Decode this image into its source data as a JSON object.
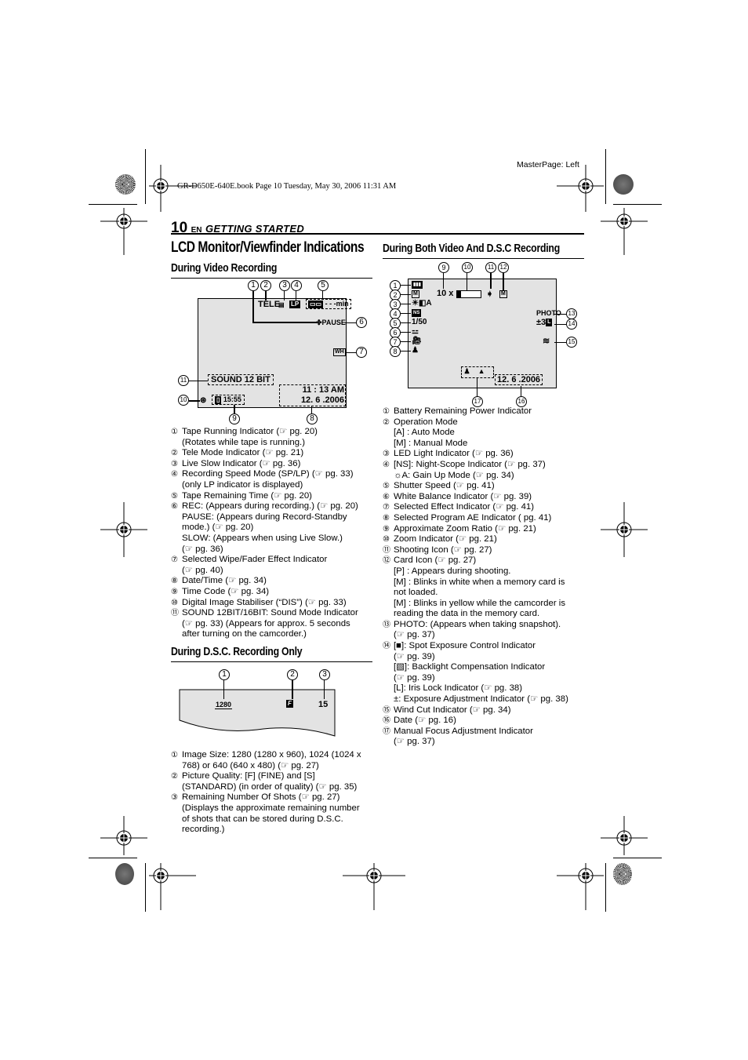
{
  "print_marks": {
    "slug": "GR-D650E-640E.book  Page 10  Tuesday, May 30, 2006  11:31 AM",
    "master_page": "MasterPage: Left"
  },
  "header": {
    "page_number": "10",
    "language": "EN",
    "section": "GETTING STARTED"
  },
  "title": "LCD Monitor/Viewfinder Indications",
  "video_recording": {
    "heading": "During Video Recording",
    "screen": {
      "tele": "TELE",
      "lp": "LP",
      "tape_remaining": "- - -min",
      "pause": "PAUSE",
      "wipe_icon": "WH",
      "sound": "SOUND  12 BIT",
      "time": "11 : 13  AM",
      "date": "12.  6 .2006",
      "timecode": "15:55"
    },
    "callouts": [
      "1",
      "2",
      "3",
      "4",
      "5",
      "6",
      "7",
      "8",
      "9",
      "10",
      "11"
    ],
    "items": [
      {
        "n": "①",
        "lines": [
          "Tape Running Indicator (☞ pg. 20)",
          "(Rotates while tape is running.)"
        ]
      },
      {
        "n": "②",
        "lines": [
          "Tele Mode Indicator (☞ pg. 21)"
        ]
      },
      {
        "n": "③",
        "lines": [
          "Live Slow Indicator (☞ pg. 36)"
        ]
      },
      {
        "n": "④",
        "lines": [
          "Recording Speed Mode (SP/LP) (☞ pg. 33)",
          "(only LP indicator is displayed)"
        ]
      },
      {
        "n": "⑤",
        "lines": [
          "Tape Remaining Time (☞ pg. 20)"
        ]
      },
      {
        "n": "⑥",
        "lines": [
          "REC: (Appears during recording.) (☞ pg. 20)",
          "PAUSE: (Appears during Record-Standby",
          "mode.) (☞ pg. 20)",
          "SLOW: (Appears when using Live Slow.)",
          "(☞ pg. 36)"
        ]
      },
      {
        "n": "⑦",
        "lines": [
          "Selected Wipe/Fader Effect Indicator",
          "(☞ pg. 40)"
        ]
      },
      {
        "n": "⑧",
        "lines": [
          "Date/Time (☞ pg. 34)"
        ]
      },
      {
        "n": "⑨",
        "lines": [
          "Time Code (☞ pg. 34)"
        ]
      },
      {
        "n": "⑩",
        "lines": [
          "Digital Image Stabiliser (“DIS”) (☞ pg. 33)"
        ]
      },
      {
        "n": "⑪",
        "lines": [
          "SOUND 12BIT/16BIT: Sound Mode Indicator",
          "(☞ pg. 33) (Appears for approx. 5 seconds",
          "after turning on the camcorder.)"
        ]
      }
    ]
  },
  "dsc_recording": {
    "heading": "During D.S.C. Recording Only",
    "screen": {
      "image_size": "1280",
      "quality_icon": "F",
      "shots": "15"
    },
    "items": [
      {
        "n": "①",
        "lines": [
          "Image Size: 1280 (1280 x 960), 1024 (1024 x",
          "768) or 640 (640 x 480) (☞ pg. 27)"
        ]
      },
      {
        "n": "②",
        "lines": [
          "Picture Quality: [F] (FINE) and [S]",
          "(STANDARD) (in order of quality) (☞ pg. 35)"
        ]
      },
      {
        "n": "③",
        "lines": [
          "Remaining Number Of Shots (☞ pg. 27)",
          "(Displays the approximate remaining number",
          "of shots that can be stored during D.S.C.",
          "recording.)"
        ]
      }
    ]
  },
  "both_recording": {
    "heading": "During Both Video And D.S.C Recording",
    "screen": {
      "zoom": "10 x",
      "photo": "PHOTO",
      "exposure": "±3",
      "date": "12.  6 .2006",
      "mode": "M",
      "led": "A",
      "shutter": "1/50"
    },
    "items": [
      {
        "n": "①",
        "lines": [
          "Battery Remaining Power Indicator"
        ]
      },
      {
        "n": "②",
        "lines": [
          "Operation Mode"
        ],
        "sub": [
          "[A] : Auto Mode",
          "[M] : Manual Mode"
        ]
      },
      {
        "n": "③",
        "lines": [
          "LED Light Indicator (☞ pg. 36)"
        ]
      },
      {
        "n": "④",
        "lines": [
          "[NS]: Night-Scope Indicator (☞ pg. 37)"
        ],
        "sub": [
          "☼A: Gain Up Mode (☞ pg. 34)"
        ]
      },
      {
        "n": "⑤",
        "lines": [
          "Shutter Speed (☞ pg. 41)"
        ]
      },
      {
        "n": "⑥",
        "lines": [
          "White Balance Indicator (☞ pg. 39)"
        ]
      },
      {
        "n": "⑦",
        "lines": [
          "Selected Effect Indicator (☞ pg. 41)"
        ]
      },
      {
        "n": "⑧",
        "lines": [
          "Selected Program AE Indicator ( pg. 41)"
        ]
      },
      {
        "n": "⑨",
        "lines": [
          "Approximate Zoom Ratio (☞ pg. 21)"
        ]
      },
      {
        "n": "⑩",
        "lines": [
          "Zoom Indicator (☞ pg. 21)"
        ]
      },
      {
        "n": "⑪",
        "lines": [
          "Shooting Icon (☞ pg. 27)"
        ]
      },
      {
        "n": "⑫",
        "lines": [
          "Card Icon (☞ pg. 27)"
        ],
        "sub": [
          "[P] : Appears during shooting.",
          "[M] : Blinks in white when a memory card is",
          "      not loaded.",
          "[M]  : Blinks in yellow while the camcorder is",
          "       reading the data in the memory card."
        ]
      },
      {
        "n": "⑬",
        "lines": [
          "PHOTO: (Appears when taking snapshot).",
          "(☞ pg. 37)"
        ]
      },
      {
        "n": "⑭",
        "lines": [
          "[■]: Spot Exposure Control Indicator",
          "(☞ pg. 39)",
          "[▧]: Backlight Compensation Indicator",
          "(☞ pg. 39)",
          "[L]: Iris Lock Indicator (☞ pg. 38)",
          "±: Exposure Adjustment Indicator (☞ pg. 38)"
        ]
      },
      {
        "n": "⑮",
        "lines": [
          "Wind Cut Indicator (☞ pg. 34)"
        ]
      },
      {
        "n": "⑯",
        "lines": [
          "Date (☞ pg. 16)"
        ]
      },
      {
        "n": "⑰",
        "lines": [
          "Manual Focus Adjustment Indicator",
          "(☞ pg. 37)"
        ]
      }
    ]
  }
}
